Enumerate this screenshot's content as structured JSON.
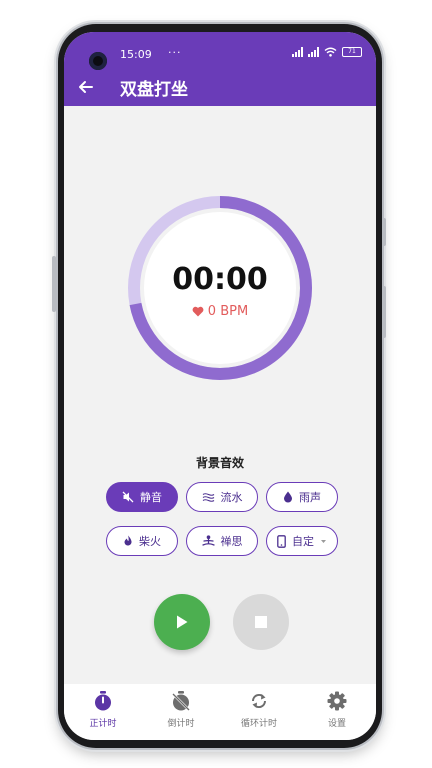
{
  "status": {
    "time": "15:09",
    "dots": "···",
    "battery": "71"
  },
  "appbar": {
    "title": "双盘打坐",
    "back_icon": "arrow-back-icon"
  },
  "timer": {
    "time": "00:00",
    "bpm": "0 BPM",
    "progress": 0.72
  },
  "sound": {
    "section_title": "背景音效",
    "options": [
      {
        "label": "静音",
        "icon": "mute-icon",
        "selected": true
      },
      {
        "label": "流水",
        "icon": "water-flow-icon",
        "selected": false
      },
      {
        "label": "雨声",
        "icon": "raindrop-icon",
        "selected": false
      },
      {
        "label": "柴火",
        "icon": "fire-icon",
        "selected": false
      },
      {
        "label": "禅思",
        "icon": "meditation-icon",
        "selected": false
      },
      {
        "label": "自定",
        "icon": "phone-icon",
        "selected": false
      }
    ]
  },
  "controls": {
    "play_icon": "play-icon",
    "stop_icon": "stop-icon"
  },
  "nav": {
    "items": [
      {
        "label": "正计时",
        "icon": "stopwatch-icon",
        "active": true
      },
      {
        "label": "倒计时",
        "icon": "timer-off-icon",
        "active": false
      },
      {
        "label": "循环计时",
        "icon": "loop-icon",
        "active": false
      },
      {
        "label": "设置",
        "icon": "gear-icon",
        "active": false
      }
    ]
  },
  "colors": {
    "primary": "#6a3cb8",
    "play": "#4caf50",
    "heart": "#e25c5c"
  }
}
